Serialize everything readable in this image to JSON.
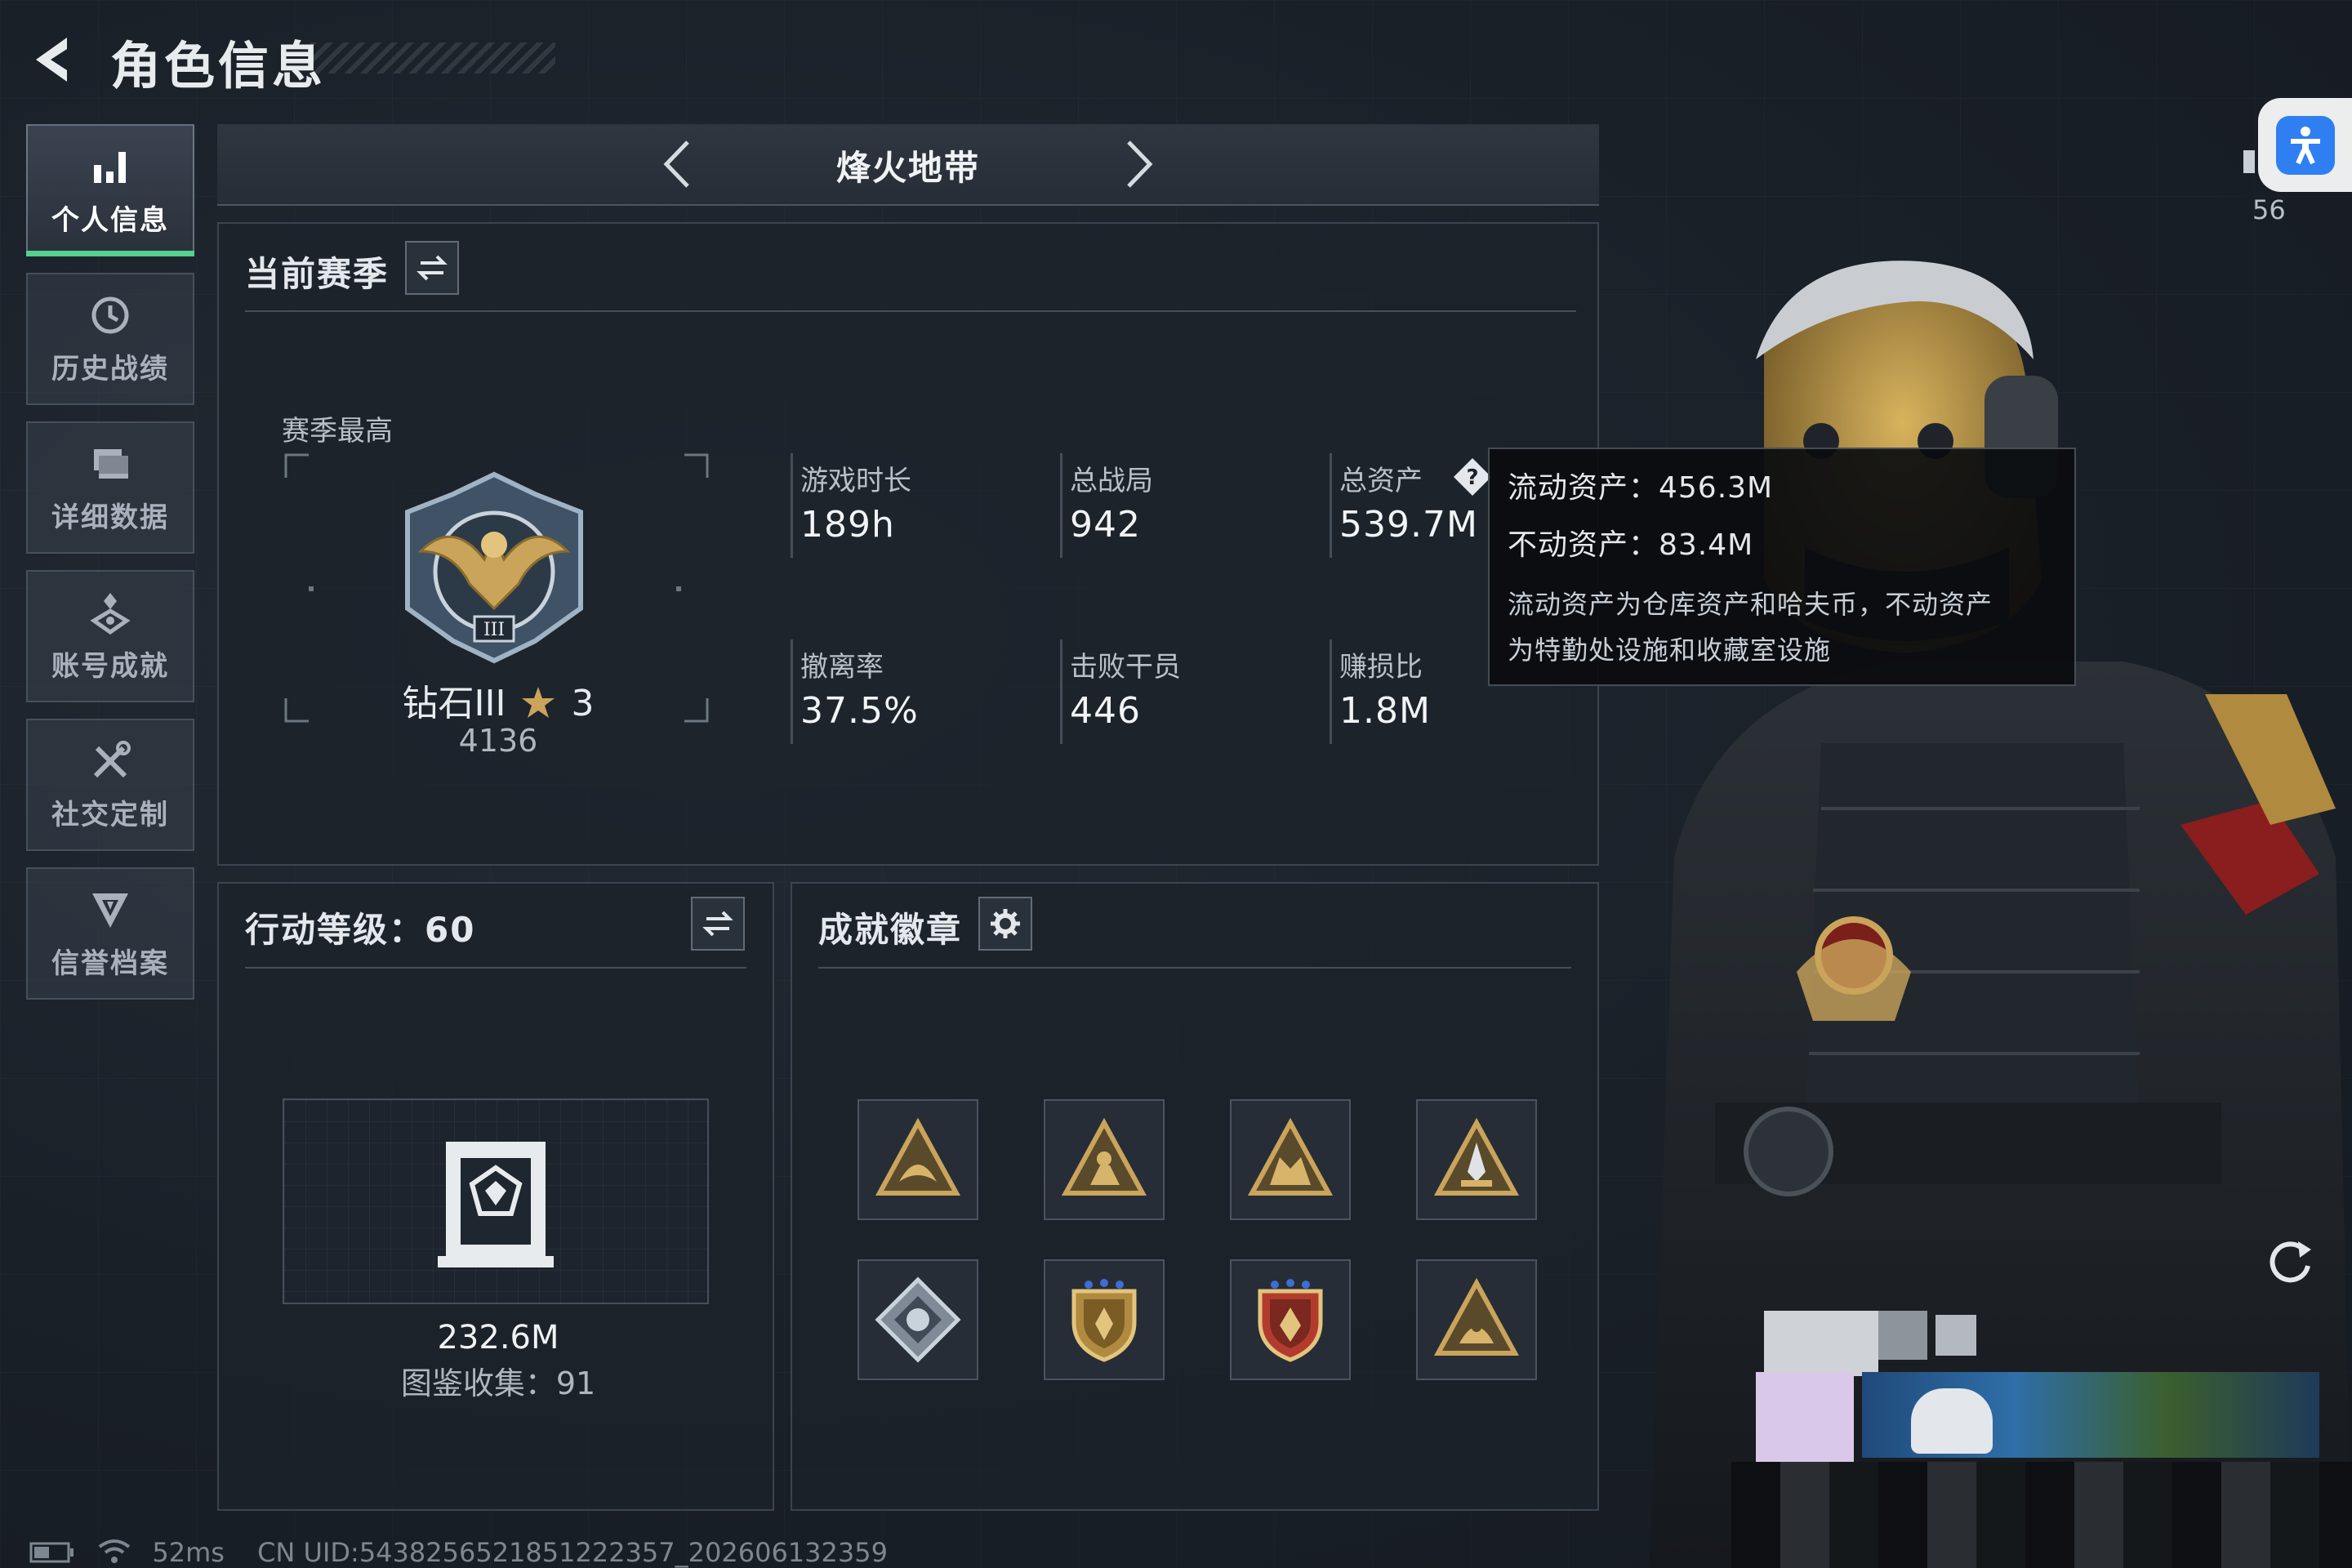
{
  "header": {
    "title": "角色信息"
  },
  "sidebar": {
    "items": [
      {
        "label": "个人信息",
        "icon": "bar-chart-icon",
        "active": true
      },
      {
        "label": "历史战绩",
        "icon": "history-clock-icon",
        "active": false
      },
      {
        "label": "详细数据",
        "icon": "folder-icon",
        "active": false
      },
      {
        "label": "账号成就",
        "icon": "achievement-icon",
        "active": false
      },
      {
        "label": "社交定制",
        "icon": "wrench-icon",
        "active": false
      },
      {
        "label": "信誉档案",
        "icon": "shield-credit-icon",
        "active": false
      }
    ]
  },
  "mode": {
    "title": "烽火地带"
  },
  "season": {
    "title": "当前赛季",
    "best_label": "赛季最高",
    "rank_name": "钻石III",
    "rank_stars": "3",
    "rank_score": "4136",
    "stats": [
      {
        "label": "游戏时长",
        "value": "189h"
      },
      {
        "label": "总战局",
        "value": "942"
      },
      {
        "label": "总资产",
        "value": "539.7M"
      },
      {
        "label": "撤离率",
        "value": "37.5%"
      },
      {
        "label": "击败干员",
        "value": "446"
      },
      {
        "label": "赚损比",
        "value": "1.8M"
      }
    ]
  },
  "tooltip": {
    "liquid": "流动资产：456.3M",
    "fixed": "不动资产：83.4M",
    "desc_line1": "流动资产为仓库资产和哈夫币，不动资产",
    "desc_line2": "为特勤处设施和收藏室设施"
  },
  "level": {
    "title": "行动等级：60",
    "asset_value": "232.6M",
    "collection": "图鉴收集：91"
  },
  "badges": {
    "title": "成就徽章",
    "items": [
      "triangle-badge-icon",
      "triangle-badge-icon",
      "triangle-badge-icon",
      "triangle-badge-icon",
      "diamond-badge-icon",
      "shield-badge-icon",
      "shield-badge-icon",
      "triangle-badge-icon"
    ]
  },
  "status": {
    "signal_count": "56",
    "ping": "52ms",
    "uid": "CN UID:5438256521851222357_202606132359"
  },
  "colors": {
    "accent_green": "#55d08e",
    "gold": "#c9a45a",
    "accessibility_blue": "#2f7ff3"
  }
}
